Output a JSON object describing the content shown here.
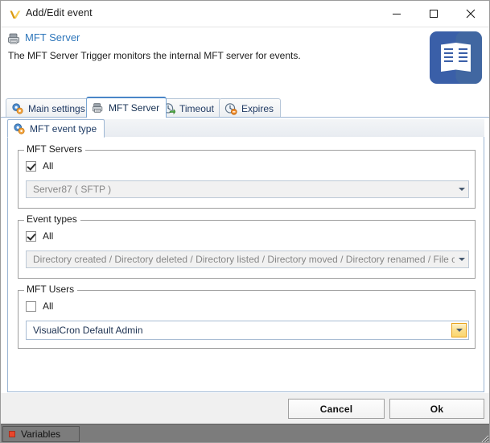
{
  "window": {
    "title": "Add/Edit event",
    "icon": "visualcron-v-icon",
    "controls": {
      "minimize": "minimize-icon",
      "maximize": "maximize-icon",
      "close": "close-icon"
    }
  },
  "header": {
    "icon": "mft-server-icon",
    "title": "MFT Server",
    "description": "The MFT Server Trigger monitors the internal MFT server for events.",
    "doc_icon": "documentation-book-icon",
    "doc_icon_color": "#3a5fa8"
  },
  "tabs": [
    {
      "label": "Main settings",
      "icon": "gears-icon",
      "active": false
    },
    {
      "label": "MFT Server",
      "icon": "mft-server-icon",
      "active": true
    },
    {
      "label": "Timeout",
      "icon": "clock-green-arrow-icon",
      "active": false
    },
    {
      "label": "Expires",
      "icon": "clock-orange-badge-icon",
      "active": false
    }
  ],
  "subtabs": [
    {
      "label": "MFT event type",
      "icon": "gears-icon",
      "active": true
    }
  ],
  "groups": {
    "mft_servers": {
      "title": "MFT Servers",
      "all_label": "All",
      "all_checked": true,
      "combo_value": "Server87 ( SFTP )",
      "combo_disabled": true
    },
    "event_types": {
      "title": "Event types",
      "all_label": "All",
      "all_checked": true,
      "combo_value": "Directory created / Directory deleted / Directory listed / Directory moved / Directory renamed / File created / F",
      "combo_disabled": true
    },
    "mft_users": {
      "title": "MFT Users",
      "all_label": "All",
      "all_checked": false,
      "combo_value": "VisualCron Default Admin",
      "combo_disabled": false,
      "combo_highlight_color": "#e8a21c"
    }
  },
  "buttons": {
    "cancel": "Cancel",
    "ok": "Ok"
  },
  "statusbar": {
    "variables_label": "Variables",
    "variables_icon": "red-square-icon",
    "resize_grip": "resize-grip-icon"
  }
}
